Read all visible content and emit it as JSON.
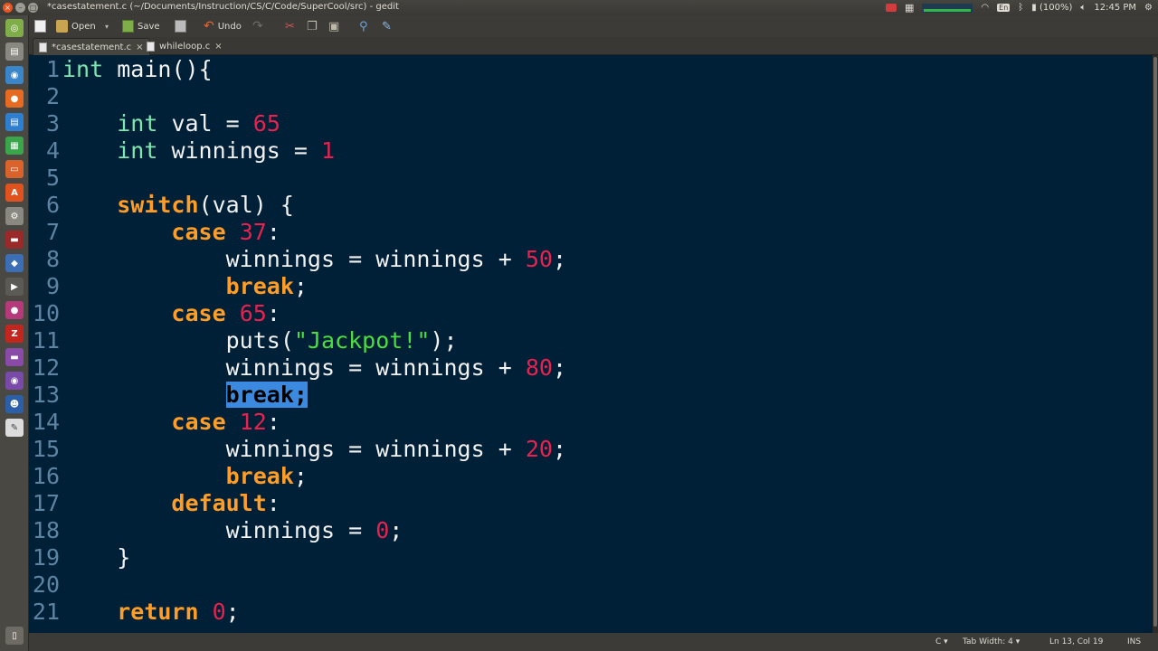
{
  "window": {
    "title": "*casestatement.c (~/Documents/Instruction/CS/C/Code/SuperCool/src) - gedit"
  },
  "tray": {
    "lang": "En",
    "battery": "(100%)",
    "time": "12:45 PM"
  },
  "toolbar": {
    "open_label": "Open",
    "save_label": "Save",
    "undo_label": "Undo"
  },
  "tabs": [
    {
      "label": "*casestatement.c",
      "active": true
    },
    {
      "label": "whileloop.c",
      "active": false
    }
  ],
  "editor": {
    "selected": "break;",
    "lines": [
      {
        "n": "1",
        "text": "int main(){"
      },
      {
        "n": "2",
        "text": ""
      },
      {
        "n": "3",
        "text": "    int val = 65"
      },
      {
        "n": "4",
        "text": "    int winnings = 1"
      },
      {
        "n": "5",
        "text": ""
      },
      {
        "n": "6",
        "text": "    switch(val) {"
      },
      {
        "n": "7",
        "text": "        case 37:"
      },
      {
        "n": "8",
        "text": "            winnings = winnings + 50;"
      },
      {
        "n": "9",
        "text": "            break;"
      },
      {
        "n": "10",
        "text": "        case 65:"
      },
      {
        "n": "11",
        "text": "            puts(\"Jackpot!\");"
      },
      {
        "n": "12",
        "text": "            winnings = winnings + 80;"
      },
      {
        "n": "13",
        "text": "            break;"
      },
      {
        "n": "14",
        "text": "        case 12:"
      },
      {
        "n": "15",
        "text": "            winnings = winnings + 20;"
      },
      {
        "n": "16",
        "text": "            break;"
      },
      {
        "n": "17",
        "text": "        default:"
      },
      {
        "n": "18",
        "text": "            winnings = 0;"
      },
      {
        "n": "19",
        "text": "    }"
      },
      {
        "n": "20",
        "text": ""
      },
      {
        "n": "21",
        "text": "    return 0;"
      }
    ]
  },
  "status": {
    "language": "C",
    "tab_width": "Tab Width: 4",
    "cursor": "Ln 13, Col 19",
    "mode": "INS"
  },
  "colors": {
    "editor_bg": "#002038",
    "keyword": "#ff9d26",
    "type": "#7fe7b2",
    "number": "#e8214f",
    "string": "#4cde3e",
    "selection": "#3c8ae0"
  }
}
